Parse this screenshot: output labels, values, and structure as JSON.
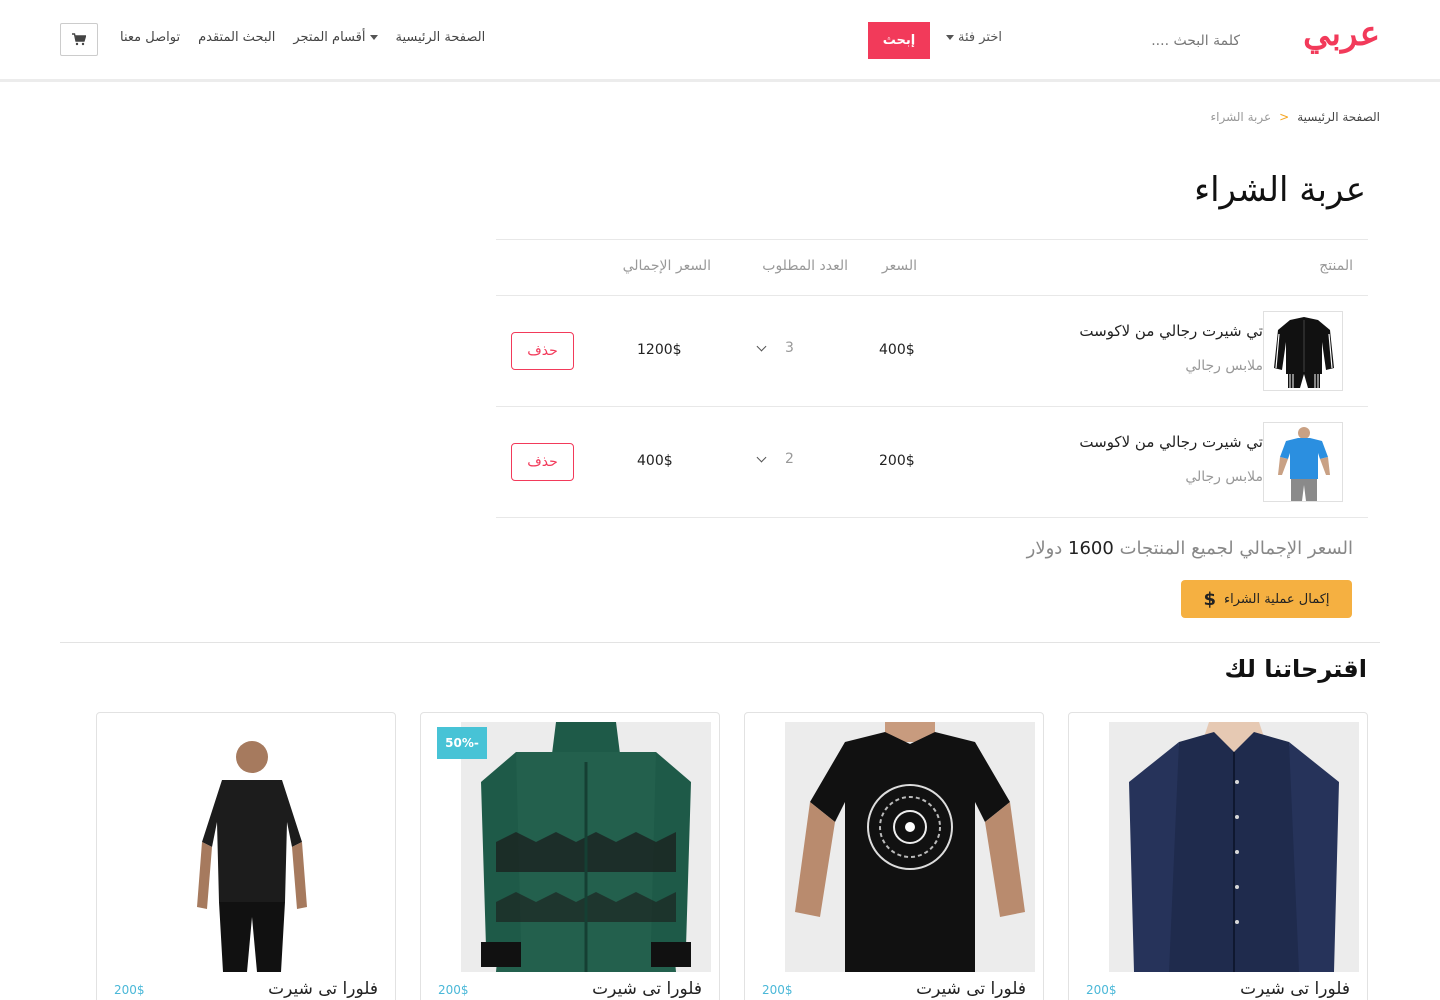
{
  "header": {
    "logo": "عربي",
    "search_placeholder": "كلمة البحث ....",
    "category_label": "اختر فئة",
    "search_button": "إبحث",
    "nav": {
      "home": "الصفحة الرئيسية",
      "sections": "أقسام المتجر",
      "advanced": "البحث المتقدم",
      "contact": "تواصل معنا"
    },
    "cart_icon": "shopping-cart-icon"
  },
  "breadcrumb": {
    "home": "الصفحة الرئيسية",
    "separator": ">",
    "current": "عربة الشراء"
  },
  "page_title": "عربة الشراء",
  "table": {
    "headers": {
      "product": "المنتج",
      "price": "السعر",
      "quantity": "العدد المطلوب",
      "total": "السعر الإجمالي"
    },
    "rows": [
      {
        "name": "تي شيرت رجالي من لاكوست",
        "category": "ملابس رجالي",
        "price": "400$",
        "qty": "3",
        "total": "1200$",
        "delete": "حذف"
      },
      {
        "name": "تي شيرت رجالي من لاكوست",
        "category": "ملابس رجالي",
        "price": "200$",
        "qty": "2",
        "total": "400$",
        "delete": "حذف"
      }
    ]
  },
  "summary": {
    "label": "السعر الإجمالي لجميع المنتجات",
    "amount": "1600",
    "currency": "دولار",
    "checkout": "إكمال عملية الشراء",
    "checkout_icon": "$"
  },
  "suggestions": {
    "title": "اقترحاتنا لك",
    "products": [
      {
        "name": "فلورا تى شيرت",
        "price": "200$",
        "badge": ""
      },
      {
        "name": "فلورا تى شيرت",
        "price": "200$",
        "badge": ""
      },
      {
        "name": "فلورا تى شيرت",
        "price": "200$",
        "badge": "50%-"
      },
      {
        "name": "فلورا تى شيرت",
        "price": "200$",
        "badge": ""
      }
    ]
  },
  "colors": {
    "brand": "#f23a5a",
    "accent": "#f5b041",
    "badge": "#47c3d6"
  }
}
